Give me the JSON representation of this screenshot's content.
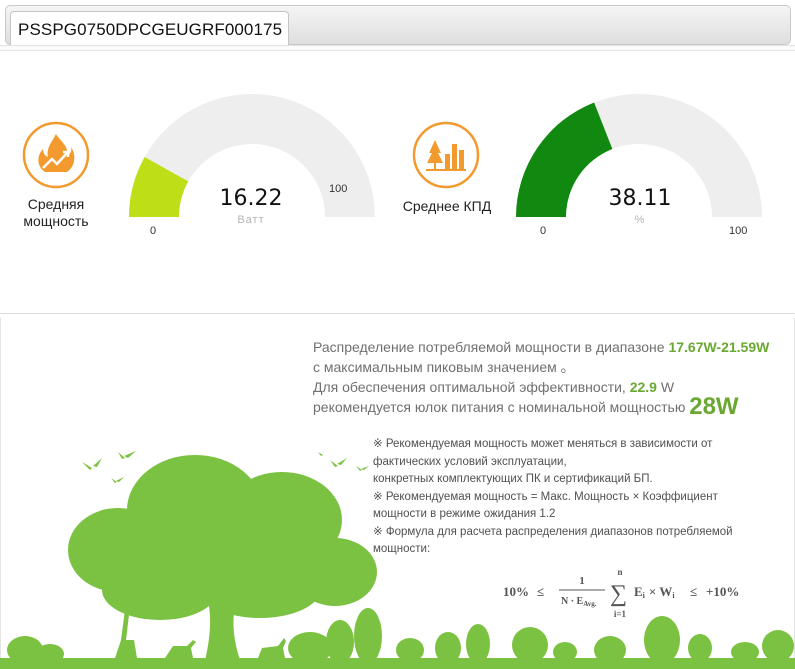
{
  "tab": {
    "label": "PSSPG0750DPCGEUGRF000175"
  },
  "gauges": [
    {
      "label_line1": "Средняя",
      "label_line2": "мощность",
      "value_text": "16.22",
      "unit": "Ватт",
      "min": "0",
      "max": "100",
      "value": 16.22,
      "color": "#bede17",
      "icon": "flame-chart-icon"
    },
    {
      "label_line1": "Среднее КПД",
      "label_line2": "",
      "value_text": "38.11",
      "unit": "%",
      "min": "0",
      "max": "100",
      "value": 38.11,
      "color": "#118810",
      "icon": "trees-chart-icon"
    }
  ],
  "info": {
    "line1_prefix": "Распределение потребляемой мощности в диапазоне ",
    "range": "17.67W-21.59W",
    "line2": "с максимальным пиковым значением 。",
    "line3_prefix": "Для обеспечения оптимальной эффективности, ",
    "optimal": "22.9",
    "optimal_unit": " W",
    "line4_prefix": "рекомендуется юлок питания с номинальной мощностью ",
    "recommended": "28W"
  },
  "notes": {
    "n1": "※ Рекомендуемая мощность может меняться в зависимости от фактических условий эксплуатации,",
    "n1b": "конкретных комплектующих ПК и сертификаций БП.",
    "n2": "※ Рекомендуемая мощность = Макс. Мощность × Коэффициент мощности в режиме ожидания 1.2",
    "n3": "※ Формула для расчета распределения диапазонов потребляемой мощности:"
  },
  "formula": {
    "left": "10%",
    "le": "≤",
    "numerator": "1",
    "denominator": "N · E",
    "denominator_sub": "Avg.",
    "sum_top": "n",
    "sum_bottom": "i=1",
    "term": "E",
    "term_sub": "i",
    "times": "× W",
    "times_sub": "i",
    "right": "+10%"
  },
  "colors": {
    "accent_orange": "#f29a2e",
    "green": "#7cc242",
    "gauge_bg": "#eeeeee"
  }
}
